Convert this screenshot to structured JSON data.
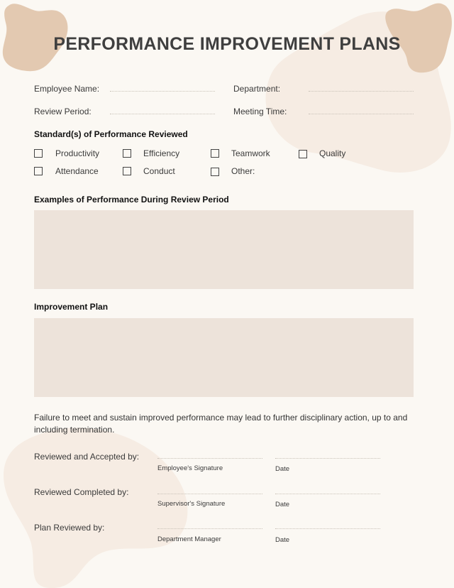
{
  "theme": {
    "background": "#fbf8f3",
    "blob_dark": "#e3c9b1",
    "blob_light": "#f6ece3",
    "text_box": "#ede3da"
  },
  "title": "PERFORMANCE IMPROVEMENT PLANS",
  "fields": {
    "employee_name": "Employee Name:",
    "department": "Department:",
    "review_period": "Review Period:",
    "meeting_time": "Meeting Time:"
  },
  "standards": {
    "heading": "Standard(s) of Performance Reviewed",
    "options": [
      {
        "label": "Productivity",
        "checked": false
      },
      {
        "label": "Efficiency",
        "checked": false
      },
      {
        "label": "Teamwork",
        "checked": false
      },
      {
        "label": "Quality",
        "checked": false
      },
      {
        "label": "Attendance",
        "checked": false
      },
      {
        "label": "Conduct",
        "checked": false
      },
      {
        "label": "Other:",
        "checked": false
      }
    ]
  },
  "examples": {
    "heading": "Examples of Performance During Review Period",
    "value": ""
  },
  "improvement": {
    "heading": "Improvement Plan",
    "value": ""
  },
  "disclaimer": "Failure to meet and sustain improved performance may lead to further disciplinary action, up to and including termination.",
  "signatures": [
    {
      "label": "Reviewed and Accepted by:",
      "signature_caption": "Employee's Signature",
      "date_caption": "Date"
    },
    {
      "label": "Reviewed Completed by:",
      "signature_caption": "Supervisor's Signature",
      "date_caption": "Date"
    },
    {
      "label": "Plan Reviewed by:",
      "signature_caption": "Department Manager",
      "date_caption": "Date"
    }
  ]
}
